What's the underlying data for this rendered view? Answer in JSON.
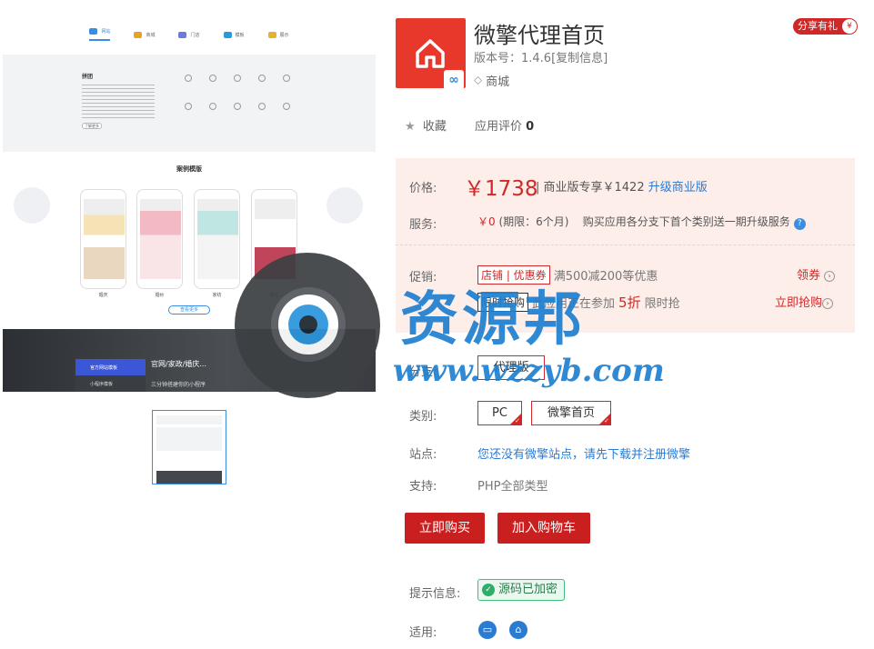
{
  "preview": {
    "nav": [
      "网站",
      "商城",
      "门店",
      "模板",
      "展示"
    ],
    "intro_title": "拼团",
    "more_button": "了解更多",
    "case_title": "案例模版",
    "phones": [
      "婚庆",
      "婚纱",
      "家纺",
      "婚礼"
    ],
    "view_more": "查看更多",
    "dark_menu": [
      "官方网站模板",
      "小程序模板"
    ],
    "dark_heading": "官网/家政/婚庆...",
    "dark_sub": "三分钟搭建你的小程序"
  },
  "watermark": {
    "text": "资源邦",
    "url": "www.wzzyb.com"
  },
  "app": {
    "title": "微擎代理首页",
    "version": "版本号：1.4.6[复制信息]",
    "category_tag": "商城",
    "share": "分享有礼",
    "favorite": "收藏",
    "rating_label": "应用评价",
    "rating_value": "0"
  },
  "pricing": {
    "price_label": "价格:",
    "price": "￥1738",
    "business_text": "| 商业版专享￥1422",
    "upgrade": "升级商业版",
    "service_label": "服务:",
    "service_value": "￥0",
    "service_period": "(期限：6个月)",
    "service_note": "购买应用各分支下首个类别送一期升级服务",
    "promo_label": "促销:",
    "promo_chip": "店铺 | 优惠券",
    "promo_text": "满500减200等优惠",
    "get_coupon": "领券",
    "flash_chip": "限时抢购",
    "flash_text": "此应用正在参加",
    "flash_discount": "5折",
    "flash_suffix": "限时抢",
    "buy_now_link": "立即抢购"
  },
  "options": {
    "branch_label": "分支:",
    "branch": "代理版",
    "type_label": "类别:",
    "types": [
      "PC",
      "微擎首页"
    ],
    "site_label": "站点:",
    "site_text": "您还没有微擎站点，请先下载并注册微擎",
    "support_label": "支持:",
    "support_text": "PHP全部类型"
  },
  "actions": {
    "buy": "立即购买",
    "cart": "加入购物车"
  },
  "info": {
    "hint_label": "提示信息:",
    "encrypted": "源码已加密",
    "apply_label": "适用:"
  },
  "colors": {
    "accent": "#c91f1f",
    "link": "#2b7bd2",
    "price_bg": "#fdeee9"
  }
}
